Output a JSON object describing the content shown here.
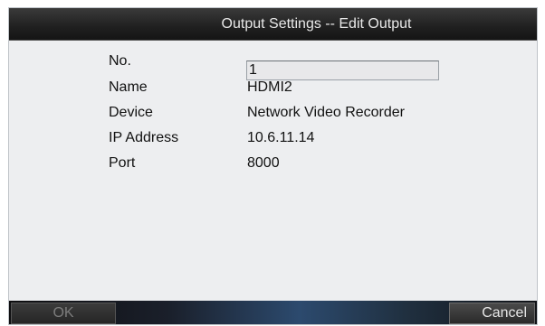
{
  "dialog": {
    "title": "Output Settings -- Edit Output"
  },
  "fields": {
    "no": {
      "label": "No.",
      "value": "1"
    },
    "name": {
      "label": "Name",
      "value": "HDMI2"
    },
    "device": {
      "label": "Device",
      "value": "Network Video Recorder"
    },
    "ip_address": {
      "label": "IP Address",
      "value": "10.6.11.14"
    },
    "port": {
      "label": "Port",
      "value": "8000"
    }
  },
  "buttons": {
    "ok_label": "OK",
    "cancel_label": "Cancel"
  }
}
